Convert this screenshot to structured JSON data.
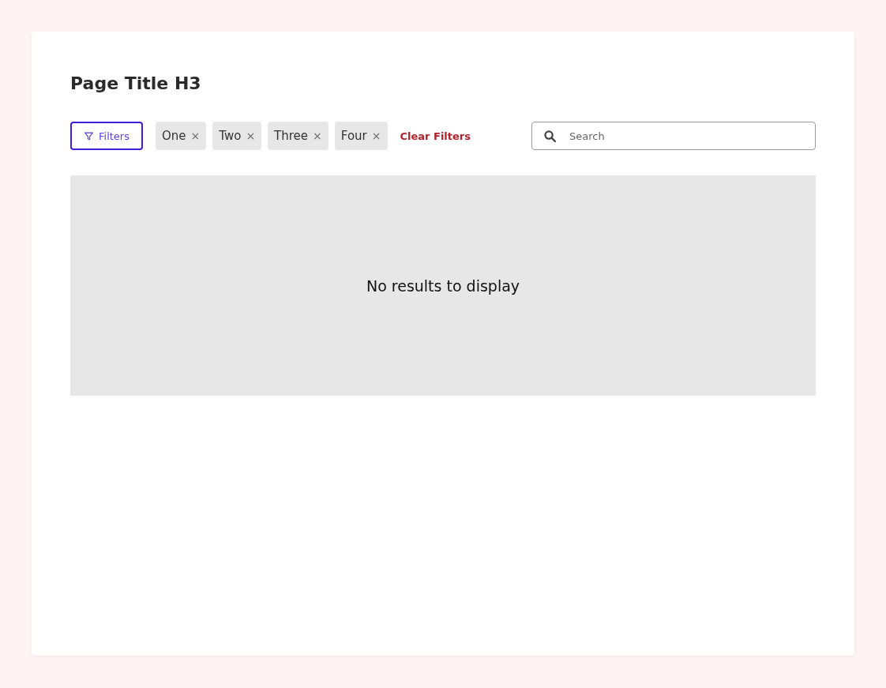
{
  "page_title": "Page Title H3",
  "filters_button": {
    "label": "Filters"
  },
  "chips": [
    {
      "label": "One",
      "remove": "×"
    },
    {
      "label": "Two",
      "remove": "×"
    },
    {
      "label": "Three",
      "remove": "×"
    },
    {
      "label": "Four",
      "remove": "×"
    }
  ],
  "clear_link": "Clear Filters",
  "search": {
    "placeholder": "Search"
  },
  "empty_state": "No results to display"
}
